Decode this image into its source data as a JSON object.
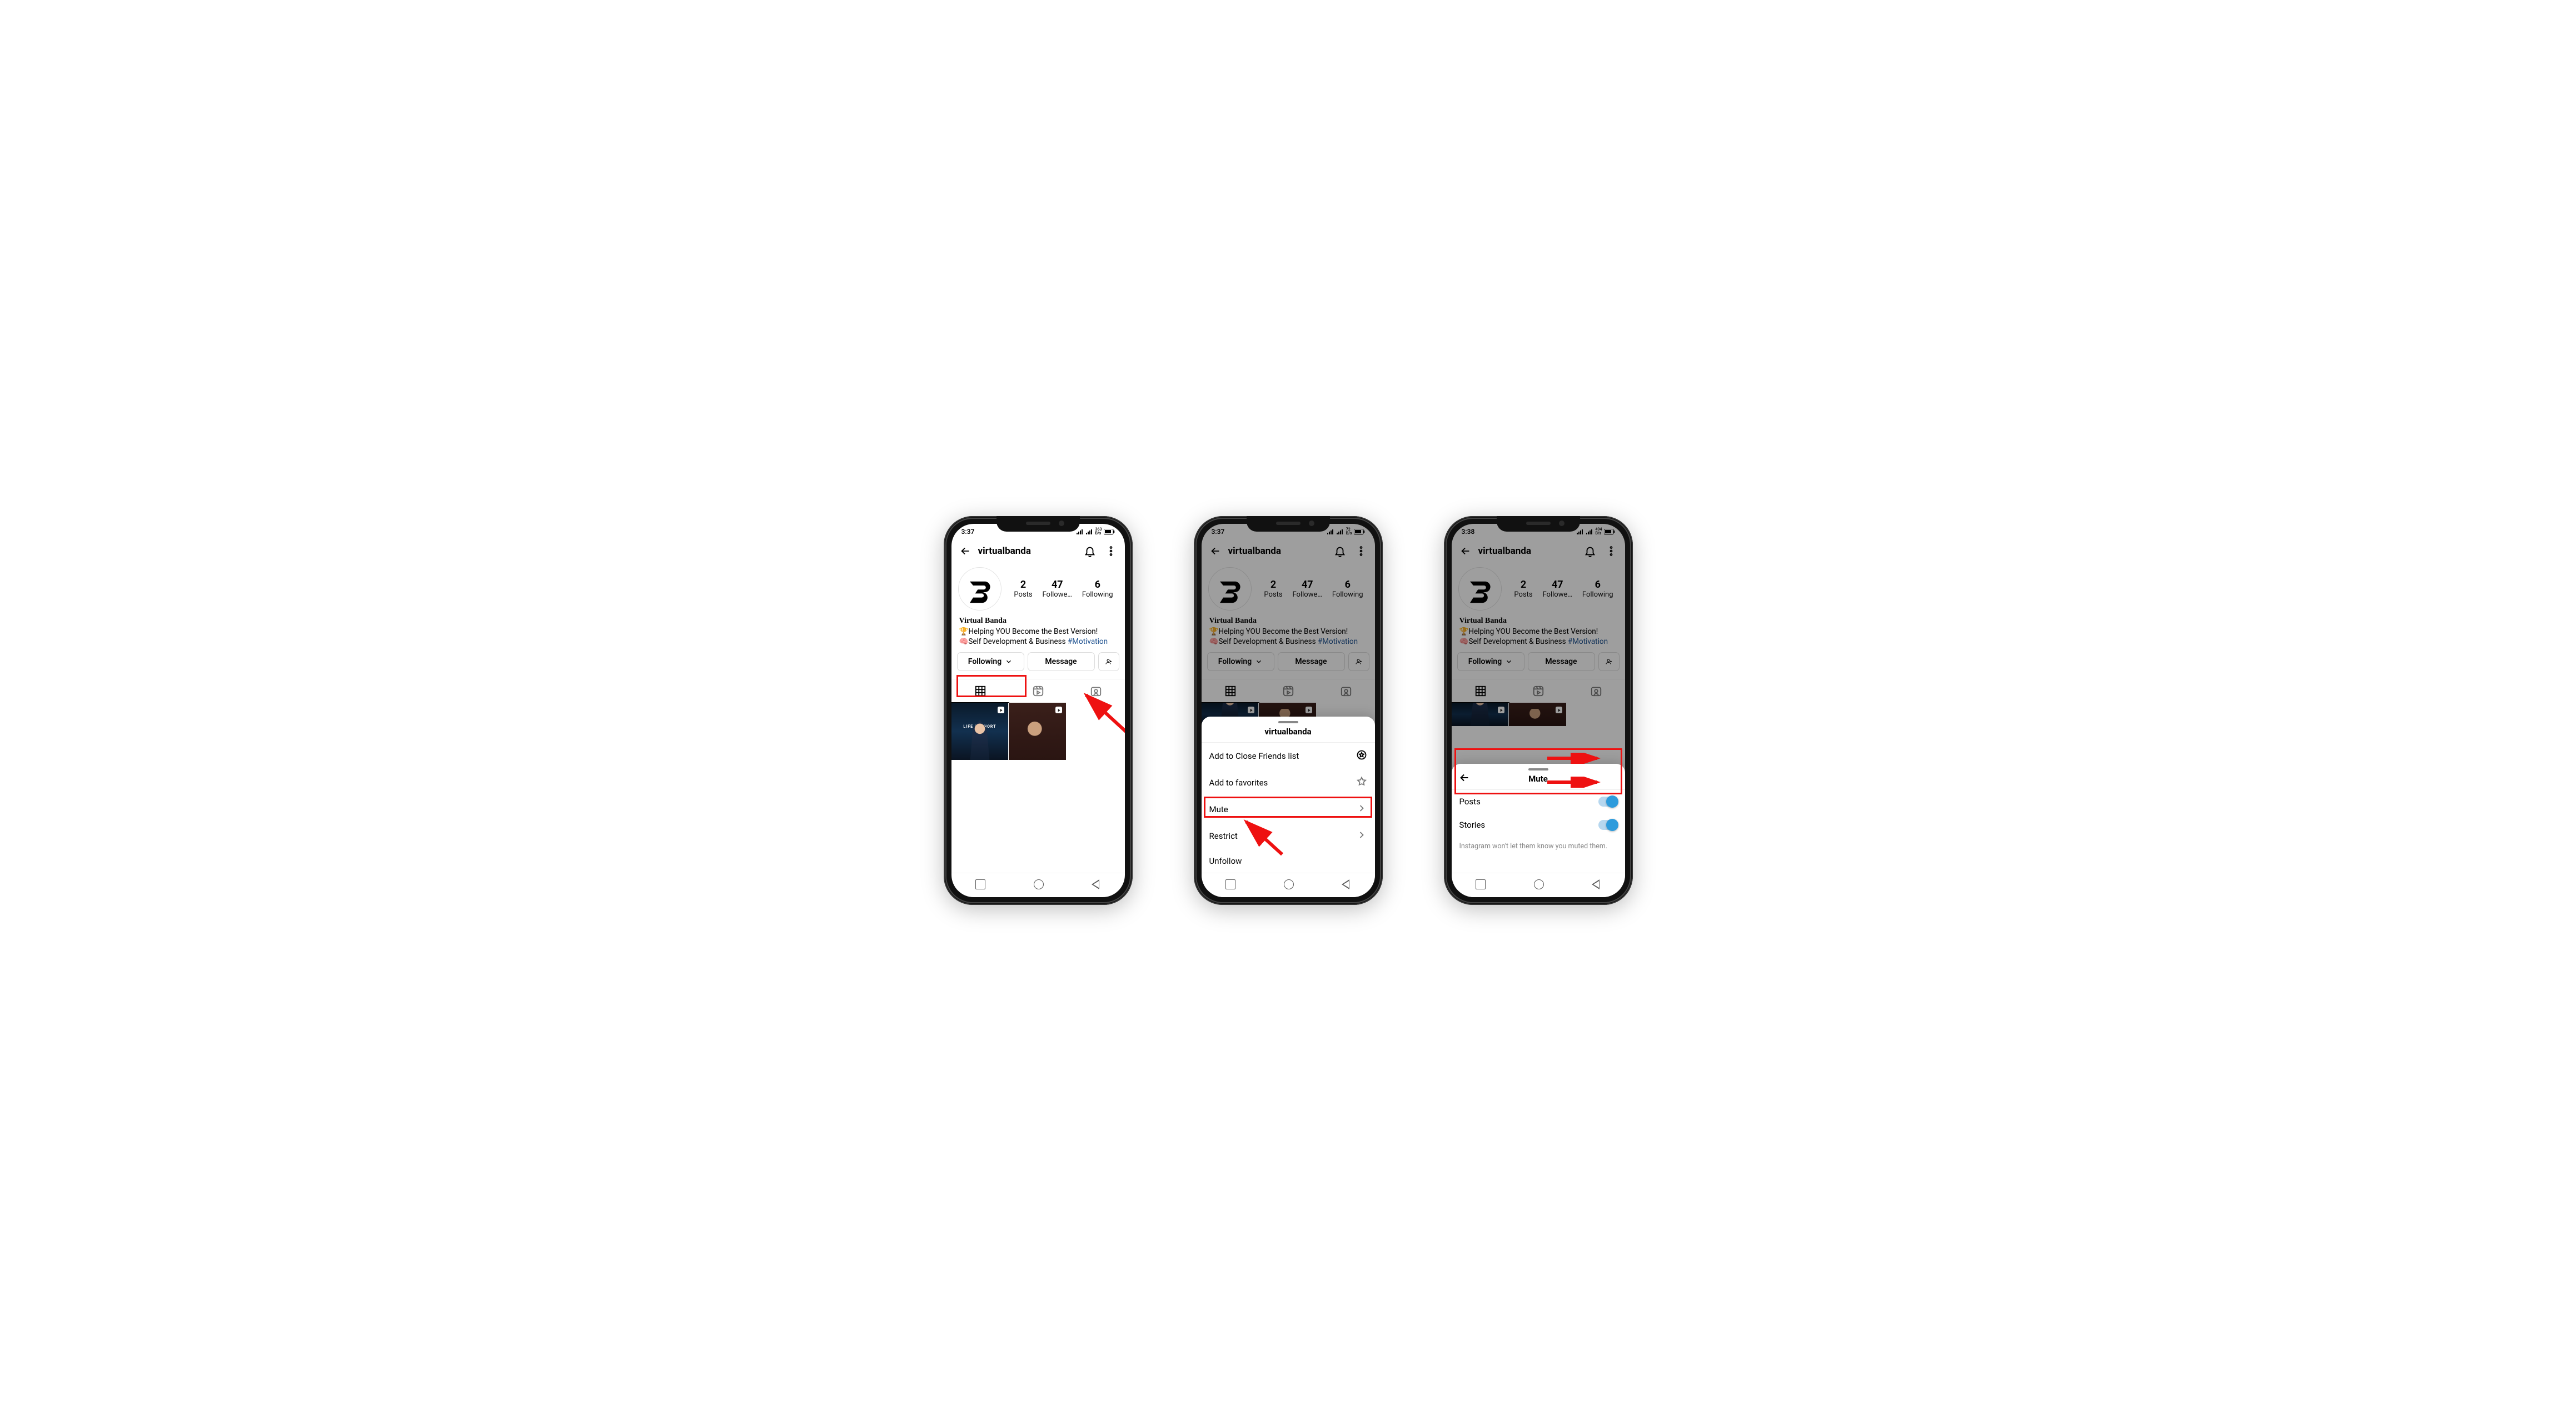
{
  "phones": {
    "p1": {
      "time": "3:37",
      "kbps": "363",
      "kbps_unit": "B/s"
    },
    "p2": {
      "time": "3:37",
      "kbps": "72",
      "kbps_unit": "B/s"
    },
    "p3": {
      "time": "3:38",
      "kbps": "494",
      "kbps_unit": "B/s"
    }
  },
  "header": {
    "username": "virtualbanda"
  },
  "stats": {
    "posts": {
      "num": "2",
      "label": "Posts"
    },
    "followers": {
      "num": "47",
      "label": "Followe…"
    },
    "following": {
      "num": "6",
      "label": "Following"
    }
  },
  "bio": {
    "display_name": "Virtual Banda",
    "line1_emoji": "🏆",
    "line1_text": "Helping YOU Become the Best Version!",
    "line2_emoji": "🧠",
    "line2_text": "Self Development & Business ",
    "hashtag": "#Motivation"
  },
  "buttons": {
    "following": "Following",
    "message": "Message"
  },
  "thumb1_caption": "LIFE IS SHORT",
  "sheet1": {
    "title": "virtualbanda",
    "rows": {
      "close_friends": "Add to Close Friends list",
      "favorites": "Add to favorites",
      "mute": "Mute",
      "restrict": "Restrict",
      "unfollow": "Unfollow"
    }
  },
  "sheet2": {
    "title": "Mute",
    "rows": {
      "posts": "Posts",
      "stories": "Stories"
    },
    "sub": "Instagram won't let them know you muted them."
  }
}
